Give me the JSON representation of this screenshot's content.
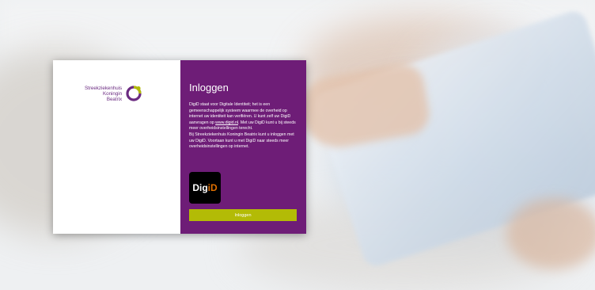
{
  "logo": {
    "line1": "Streekziekenhuis",
    "line2": "Koningin",
    "line3": "Beatrix",
    "icon": "skb-ring-logo"
  },
  "login": {
    "title": "Inloggen",
    "paragraph1_before_link": "DigiD staat voor Digitale Identiteit; het is een gemeenschappelijk systeem waarmee de overheid op internet uw identiteit kan verifiëren. U kunt zelf uw DigiD aanvragen op ",
    "paragraph1_link": "www.digid.nl",
    "paragraph1_after_link": ". Met uw DigiD kunt u bij steeds meer overheidsinstellingen terecht.",
    "paragraph2": "Bij Streekziekenhuis Koningin Beatrix kunt u inloggen met uw DigiD. Voortaan kunt u met DigiD naar steeds meer overheidsinstellingen op internet.",
    "digid_logo_part1": "Dig",
    "digid_logo_part2": "iD",
    "button_label": "Inloggen"
  },
  "colors": {
    "panel_purple": "#6e1d77",
    "button_green": "#b3bb06",
    "digid_orange": "#e17000",
    "logo_purple": "#6b2b81",
    "logo_lime": "#b3bb06"
  }
}
